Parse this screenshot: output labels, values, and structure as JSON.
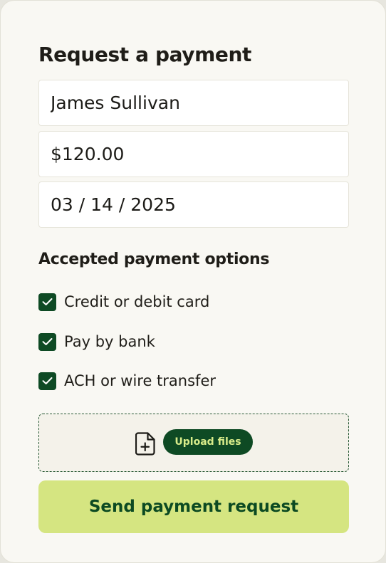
{
  "form": {
    "title": "Request a payment",
    "name_value": "James Sullivan",
    "amount_value": "$120.00",
    "date_value": "03 / 14 / 2025"
  },
  "payment_options": {
    "title": "Accepted payment options",
    "items": [
      {
        "label": "Credit or debit card",
        "checked": true
      },
      {
        "label": "Pay by bank",
        "checked": true
      },
      {
        "label": "ACH or wire transfer",
        "checked": true
      }
    ]
  },
  "upload": {
    "icon": "file-add-icon",
    "button_label": "Upload files"
  },
  "submit": {
    "label": "Send payment request"
  },
  "colors": {
    "card_background": "#f9f8f3",
    "checkbox_fill": "#0e4a24",
    "upload_button_fill": "#0e4a24",
    "upload_button_text": "#d8ec8a",
    "send_button_fill": "#d5e581",
    "send_button_text": "#0c4a22"
  }
}
